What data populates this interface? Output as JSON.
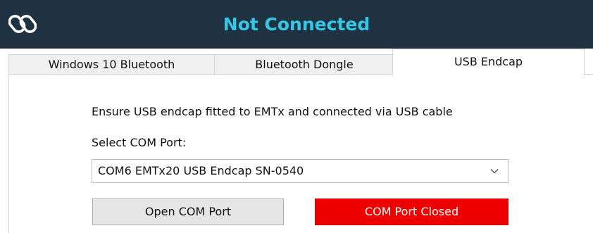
{
  "app": {
    "status_title": "Not Connected",
    "icon": "link-icon",
    "colors": {
      "titlebar_bg": "#1f3241",
      "title_text": "#35c8e6",
      "closed_button_bg": "#ef0000"
    }
  },
  "tabs": [
    {
      "label": "Windows 10 Bluetooth",
      "active": false
    },
    {
      "label": "Bluetooth Dongle",
      "active": false
    },
    {
      "label": "USB Endcap",
      "active": true
    }
  ],
  "usb_panel": {
    "instruction": "Ensure USB endcap fitted to EMTx and connected via USB cable",
    "select_label": "Select COM Port:",
    "com_port_selected": "COM6 EMTx20 USB Endcap SN-0540",
    "open_button_label": "Open COM Port",
    "status_button_label": "COM Port Closed"
  }
}
